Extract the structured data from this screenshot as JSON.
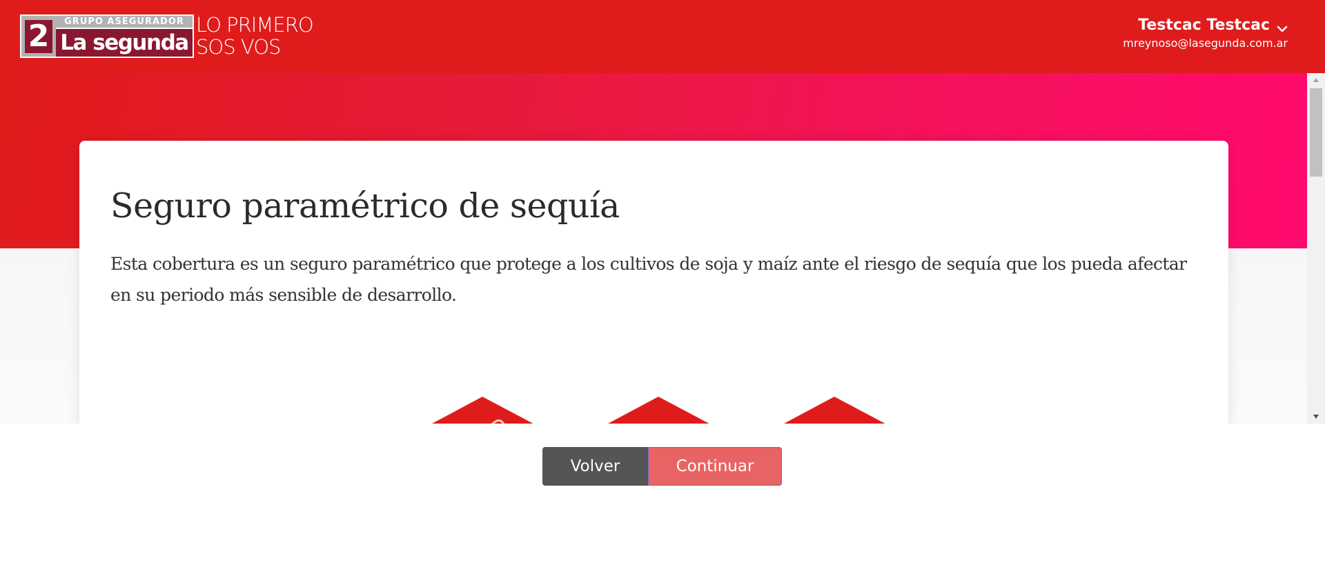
{
  "header": {
    "logo": {
      "mark": "2",
      "top_text": "GRUPO ASEGURADOR",
      "name": "La segunda"
    },
    "tagline_line1": "LO PRIMERO",
    "tagline_line2": "SOS VOS",
    "user": {
      "name": "Testcac Testcac",
      "email": "mreynoso@lasegunda.com.ar",
      "dropdown_icon": "chevron-down-icon"
    }
  },
  "card": {
    "title": "Seguro paramétrico de sequía",
    "description": "Esta cobertura es un seguro paramétrico que protege a los cultivos de soja y maíz ante el riesgo de sequía que los pueda afectar en su periodo más sensible de desarrollo.",
    "icons": [
      "plant-hand-icon",
      "document-icon",
      "money-hand-icon"
    ]
  },
  "actions": {
    "back_label": "Volver",
    "continue_label": "Continuar"
  },
  "colors": {
    "header_red": "#e01b1b",
    "hero_pink": "#ff0a6e",
    "icon_red": "#e01b1b",
    "back_gray": "#555555",
    "continue_salmon": "#e86363"
  }
}
